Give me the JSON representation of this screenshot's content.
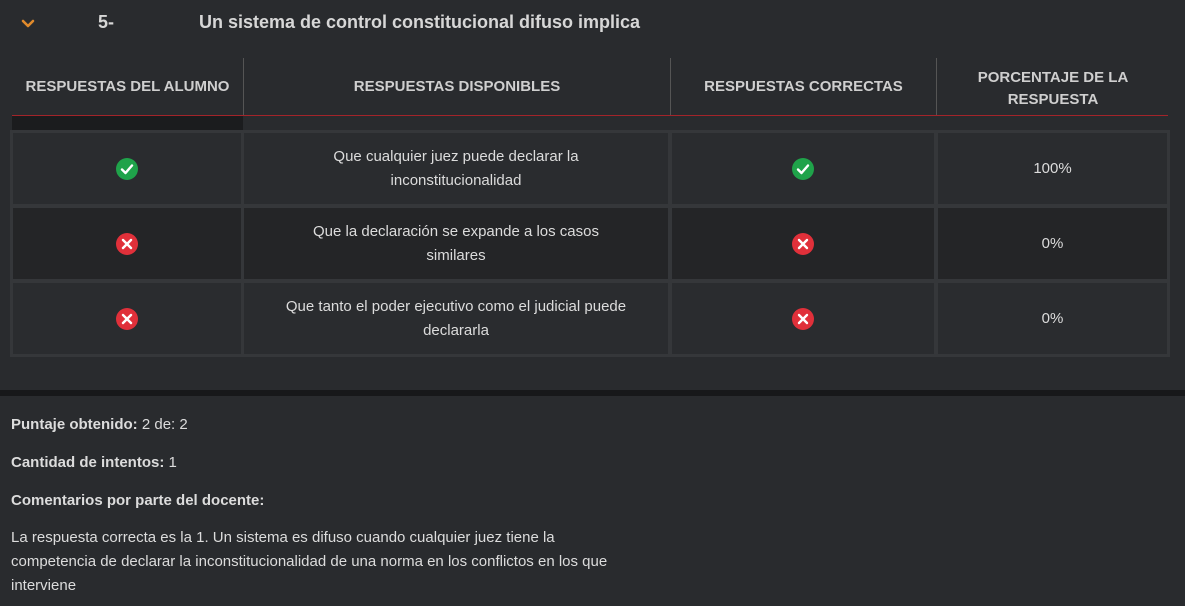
{
  "question": {
    "number": "5-",
    "title": "Un sistema de control constitucional difuso implica"
  },
  "table": {
    "headers": {
      "student": "RESPUESTAS DEL ALUMNO",
      "available": "RESPUESTAS DISPONIBLES",
      "correct": "RESPUESTAS CORRECTAS",
      "percentage": "PORCENTAJE DE LA RESPUESTA"
    },
    "rows": [
      {
        "student_icon": "check-circle-icon",
        "answer": "Que cualquier juez puede declarar la inconstitucionalidad",
        "correct_icon": "check-circle-icon",
        "percentage": "100%"
      },
      {
        "student_icon": "x-circle-icon",
        "answer": "Que la declaración se expande a los casos similares",
        "correct_icon": "x-circle-icon",
        "percentage": "0%"
      },
      {
        "student_icon": "x-circle-icon",
        "answer": "Que tanto el poder ejecutivo como el judicial puede declararla",
        "correct_icon": "x-circle-icon",
        "percentage": "0%"
      }
    ]
  },
  "summary": {
    "score_label": "Puntaje obtenido:",
    "score_value": "2 de: 2",
    "attempts_label": "Cantidad de intentos:",
    "attempts_value": "1",
    "comments_label": "Comentarios por parte del docente:",
    "comment_text": "La respuesta correcta es la 1. Un sistema es difuso cuando cualquier juez tiene la competencia de declarar la inconstitucionalidad de una norma en los conflictos en los que interviene"
  },
  "colors": {
    "background": "#292b2e",
    "accent_orange": "#e08a2c",
    "success_green": "#1fa34a",
    "error_red": "#e0303a",
    "header_rule": "#a3242a"
  }
}
